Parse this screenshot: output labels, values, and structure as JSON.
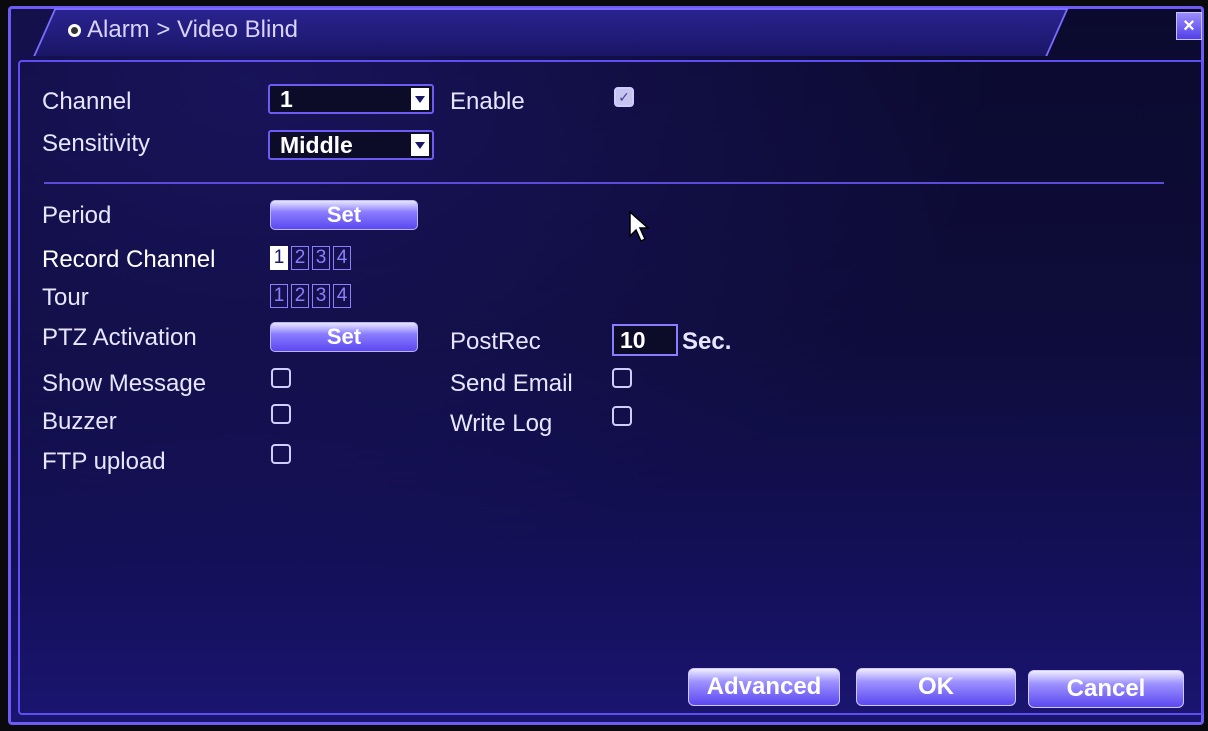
{
  "window": {
    "title": "Alarm > Video Blind",
    "close_label": "×"
  },
  "form": {
    "channel_label": "Channel",
    "channel_value": "1",
    "enable_label": "Enable",
    "enable_checked": true,
    "sensitivity_label": "Sensitivity",
    "sensitivity_value": "Middle",
    "period_label": "Period",
    "period_button": "Set",
    "record_channel_label": "Record Channel",
    "record_channels": [
      "1",
      "2",
      "3",
      "4"
    ],
    "tour_label": "Tour",
    "tour_channels": [
      "1",
      "2",
      "3",
      "4"
    ],
    "ptz_label": "PTZ Activation",
    "ptz_button": "Set",
    "postrec_label": "PostRec",
    "postrec_value": "10",
    "postrec_unit": "Sec.",
    "show_message_label": "Show Message",
    "send_email_label": "Send Email",
    "buzzer_label": "Buzzer",
    "write_log_label": "Write Log",
    "ftp_upload_label": "FTP upload"
  },
  "buttons": {
    "advanced": "Advanced",
    "ok": "OK",
    "cancel": "Cancel"
  },
  "colors": {
    "accent": "#6d5cf4",
    "background": "#0e0c3a"
  }
}
